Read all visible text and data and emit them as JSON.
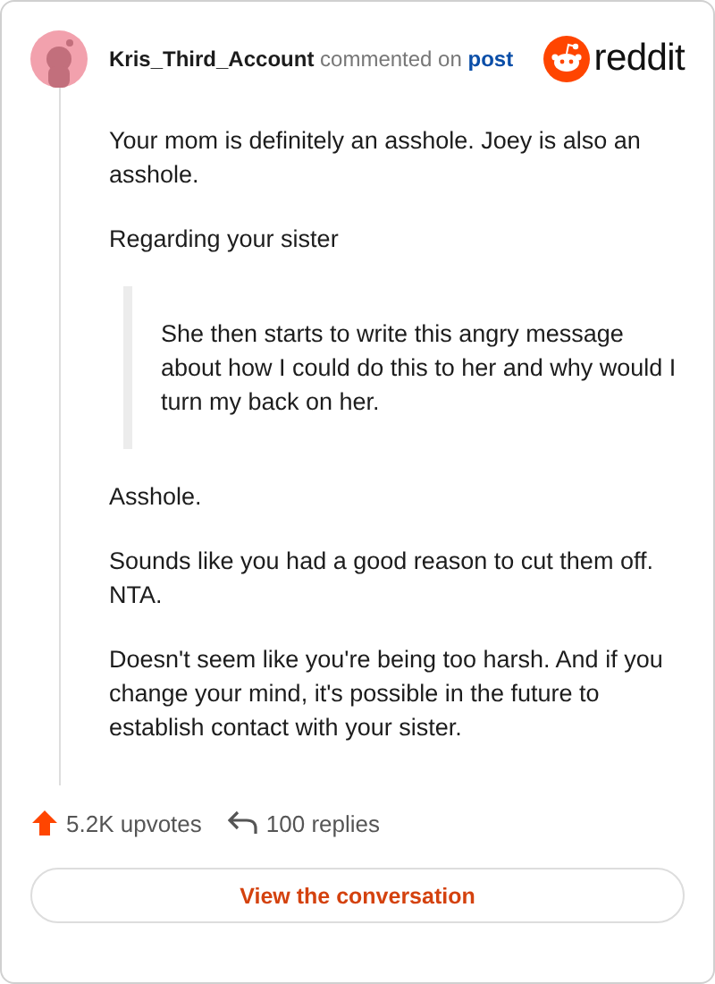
{
  "header": {
    "author": "Kris_Third_Account",
    "action": "commented on",
    "target": "post",
    "brand": "reddit"
  },
  "body": [
    {
      "kind": "text",
      "text": "Your mom is definitely an asshole. Joey is also an asshole."
    },
    {
      "kind": "text",
      "text": "Regarding your sister"
    },
    {
      "kind": "quote",
      "text": "She then starts to write this angry message about how I could do this to her and why would I turn my back on her."
    },
    {
      "kind": "text",
      "text": "Asshole."
    },
    {
      "kind": "text",
      "text": "Sounds like you had a good reason to cut them off. NTA."
    },
    {
      "kind": "text",
      "text": "Doesn't seem like you're being too harsh. And if you change your mind, it's possible in the future to establish contact with your sister."
    }
  ],
  "footer": {
    "upvotes": "5.2K upvotes",
    "replies": "100 replies",
    "button": "View the conversation"
  }
}
